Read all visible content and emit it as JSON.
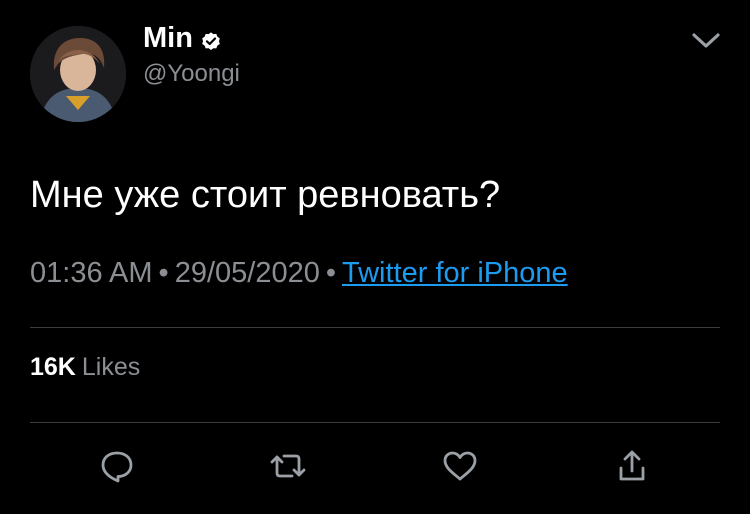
{
  "author": {
    "display_name": "Min",
    "handle": "@Yoongi",
    "verified": true
  },
  "tweet": {
    "text": "Мне уже стоит ревновать?",
    "time": "01:36 AM",
    "date": "29/05/2020",
    "source": "Twitter for iPhone"
  },
  "stats": {
    "likes_count": "16K",
    "likes_label": "Likes"
  },
  "icons": {
    "verified": "verified-badge-icon",
    "menu": "chevron-down-icon",
    "reply": "reply-icon",
    "retweet": "retweet-icon",
    "like": "heart-icon",
    "share": "share-icon"
  },
  "colors": {
    "background": "#000000",
    "text": "#ffffff",
    "muted": "#8b8f94",
    "link": "#1d9bf0",
    "divider": "#3a3d40"
  }
}
